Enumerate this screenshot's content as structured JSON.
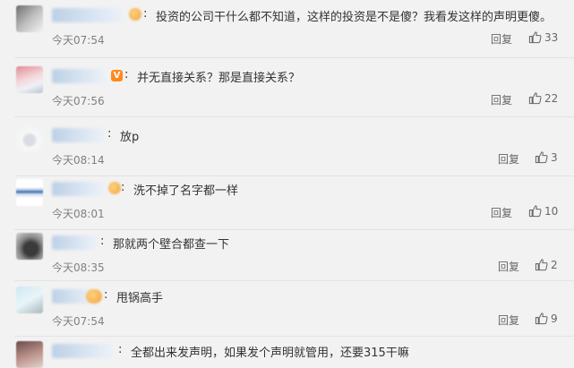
{
  "comments": [
    {
      "text": "投资的公司干什么都不知道，这样的投资是不是傻？我看发这样的声明更傻。",
      "time": "今天07:54",
      "reply": "回复",
      "likes": "33"
    },
    {
      "text": "并无直接关系？那是直接关系？",
      "time": "今天07:56",
      "reply": "回复",
      "likes": "22"
    },
    {
      "text": "放p",
      "time": "今天08:14",
      "reply": "回复",
      "likes": "3"
    },
    {
      "text": "洗不掉了名字都一样",
      "time": "今天08:01",
      "reply": "回复",
      "likes": "10"
    },
    {
      "text": "那就两个壁合都查一下",
      "time": "今天08:35",
      "reply": "回复",
      "likes": "2"
    },
    {
      "text": "甩锅高手",
      "time": "今天07:54",
      "reply": "回复",
      "likes": "9"
    },
    {
      "text": "全都出来发声明，如果发个声明就管用，还要315干嘛",
      "time": "",
      "reply": "",
      "likes": ""
    }
  ],
  "icons": {
    "like": "thumbs-up-icon",
    "verified": "v-badge-icon"
  },
  "colors": {
    "background": "#f2f2f2",
    "text": "#333333",
    "meta": "#808080",
    "divider": "#e3e3e3"
  }
}
